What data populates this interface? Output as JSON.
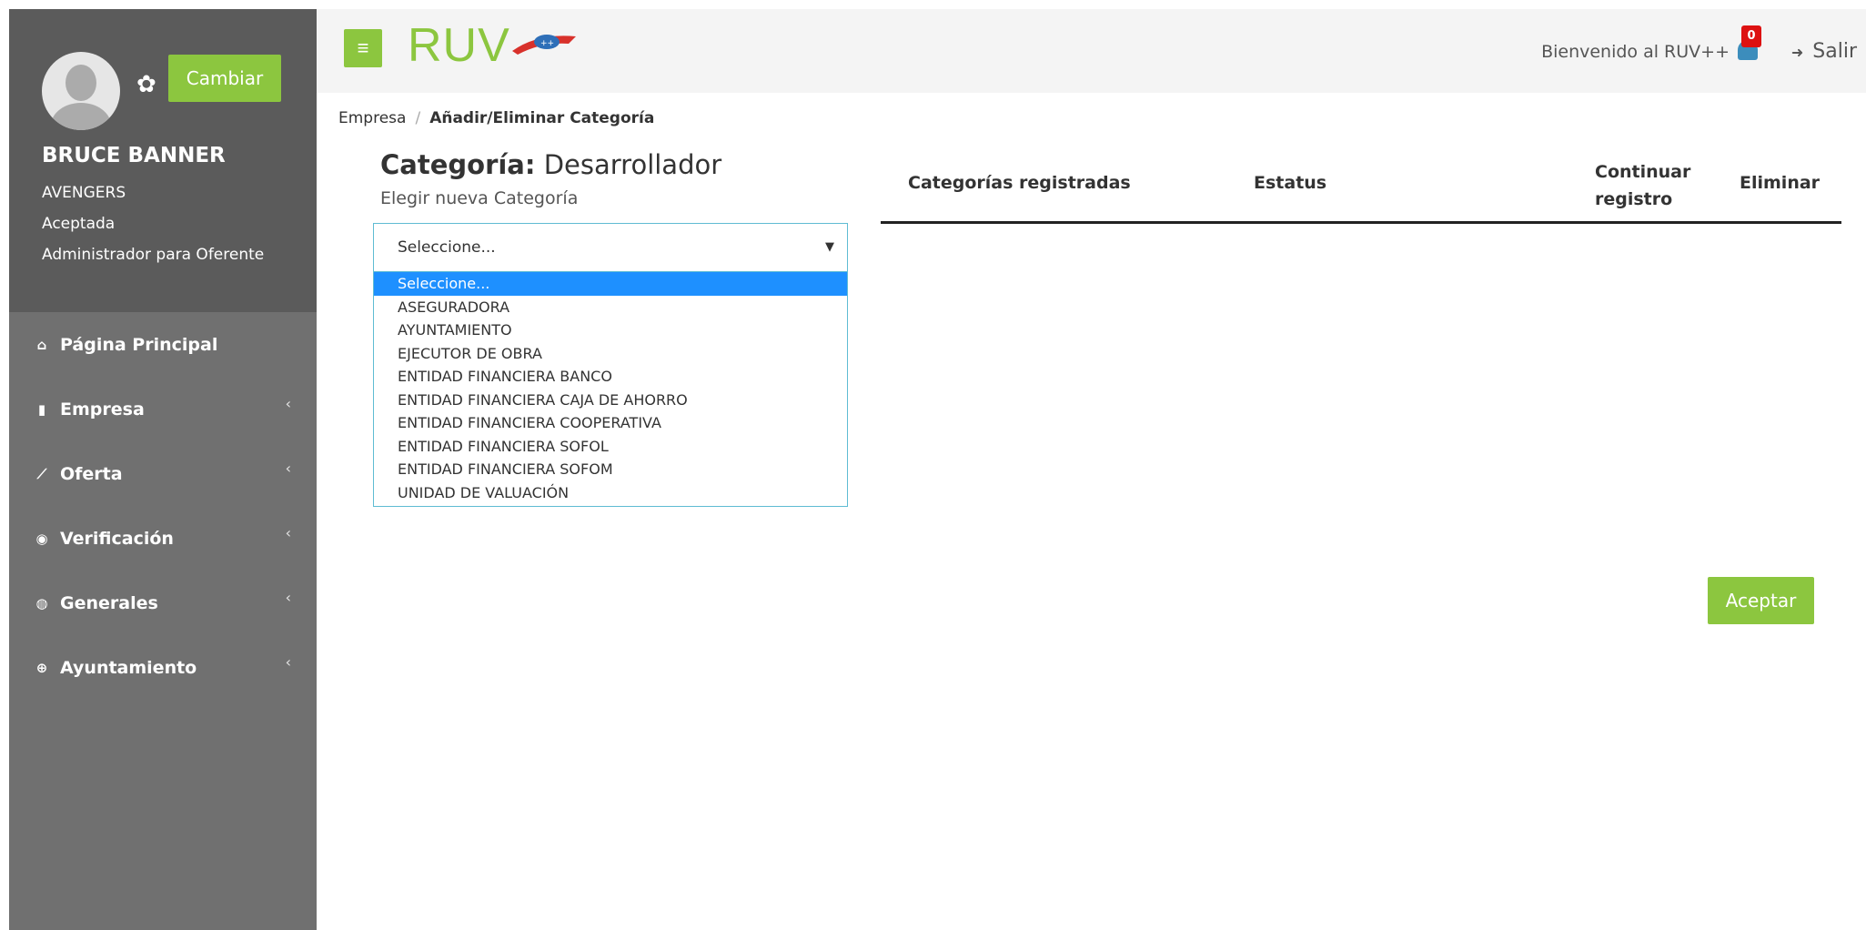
{
  "sidebar": {
    "change_button": "Cambiar",
    "user": {
      "name": "BRUCE BANNER",
      "company": "AVENGERS",
      "status": "Aceptada",
      "role": "Administrador para Oferente"
    },
    "nav": [
      {
        "label": "Página Principal",
        "icon": "home-icon"
      },
      {
        "label": "Empresa",
        "icon": "building-icon"
      },
      {
        "label": "Oferta",
        "icon": "line-chart-icon"
      },
      {
        "label": "Verificación",
        "icon": "target-icon"
      },
      {
        "label": "Generales",
        "icon": "dashboard-icon"
      },
      {
        "label": "Ayuntamiento",
        "icon": "plus-circle-icon"
      }
    ]
  },
  "header": {
    "logo_text": "RUV",
    "welcome": "Bienvenido al RUV++",
    "notifications_count": "0",
    "logout_label": "Salir"
  },
  "breadcrumb": {
    "parent": "Empresa",
    "current": "Añadir/Eliminar Categoría"
  },
  "form": {
    "category_label": "Categoría:",
    "category_value": "Desarrollador",
    "choose_label": "Elegir nueva Categoría",
    "select_value": "Seleccione...",
    "options": [
      "Seleccione...",
      "ASEGURADORA",
      "AYUNTAMIENTO",
      "EJECUTOR DE OBRA",
      "ENTIDAD FINANCIERA BANCO",
      "ENTIDAD FINANCIERA CAJA DE AHORRO",
      "ENTIDAD FINANCIERA COOPERATIVA",
      "ENTIDAD FINANCIERA SOFOL",
      "ENTIDAD FINANCIERA SOFOM",
      "UNIDAD DE VALUACIÓN"
    ]
  },
  "table": {
    "headers": [
      "Categorías registradas",
      "Estatus",
      "Continuar registro",
      "Eliminar"
    ]
  },
  "accept_button": "Aceptar",
  "colors": {
    "accent_green": "#8cc63f",
    "sidebar": "#707070",
    "sidebar_profile": "#5b5b5b",
    "badge_red": "#dd1111",
    "option_selected": "#1e90ff"
  }
}
